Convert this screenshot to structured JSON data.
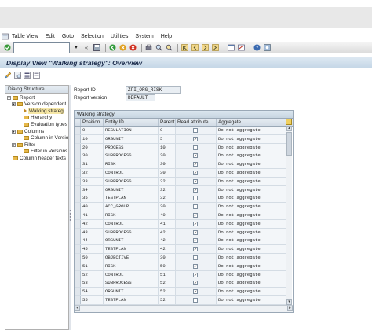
{
  "menu": {
    "items": [
      "Table View",
      "Edit",
      "Goto",
      "Selection",
      "Utilities",
      "System",
      "Help"
    ]
  },
  "toolbar": {
    "command_field_value": "",
    "icons": [
      "enter-icon",
      "save-icon",
      "back-icon",
      "exit-icon",
      "cancel-icon",
      "print-icon",
      "find-icon",
      "find-next-icon",
      "first-page-icon",
      "previous-page-icon",
      "next-page-icon",
      "last-page-icon",
      "create-session-icon",
      "shortcut-icon",
      "help-icon",
      "customize-layout-icon"
    ]
  },
  "title": "Display View \"Walking strategy\": Overview",
  "app_toolbar": {
    "icons": [
      "display-change-icon",
      "details-icon",
      "select-all-icon",
      "deselect-all-icon"
    ]
  },
  "tree": {
    "header": "Dialog Structure",
    "nodes": [
      {
        "label": "Report",
        "level": 0,
        "kind": "folder",
        "toggle": "▾"
      },
      {
        "label": "Version dependent",
        "level": 1,
        "kind": "folder",
        "toggle": "▾"
      },
      {
        "label": "Walking strateg",
        "level": 2,
        "kind": "arrow",
        "toggle": "",
        "selected": true
      },
      {
        "label": "Hierarchy",
        "level": 2,
        "kind": "folder",
        "toggle": ""
      },
      {
        "label": "Evaluation types",
        "level": 2,
        "kind": "folder",
        "toggle": ""
      },
      {
        "label": "Columns",
        "level": 1,
        "kind": "folder",
        "toggle": "▾"
      },
      {
        "label": "Column in Versio",
        "level": 2,
        "kind": "folder",
        "toggle": ""
      },
      {
        "label": "Filter",
        "level": 1,
        "kind": "folder",
        "toggle": "▾"
      },
      {
        "label": "Filter in Versions",
        "level": 2,
        "kind": "folder",
        "toggle": ""
      },
      {
        "label": "Column header texts",
        "level": 0,
        "kind": "folder",
        "toggle": ""
      }
    ]
  },
  "report_fields": {
    "report_id_label": "Report ID",
    "report_id_value": "ZFI_ORG_RISK",
    "report_version_label": "Report version",
    "report_version_value": "DEFAULT"
  },
  "table": {
    "title": "Walking strategy",
    "columns": [
      "Position",
      "Entity ID",
      "Parent",
      "Read attribute",
      "Aggregate"
    ],
    "rows": [
      {
        "position": "0",
        "entity": "REGULATION",
        "parent": "0",
        "read": false,
        "aggregate": "Do not aggregate"
      },
      {
        "position": "10",
        "entity": "ORGUNIT",
        "parent": "5",
        "read": true,
        "aggregate": "Do not aggregate"
      },
      {
        "position": "20",
        "entity": "PROCESS",
        "parent": "10",
        "read": false,
        "aggregate": "Do not aggregate"
      },
      {
        "position": "30",
        "entity": "SUBPROCESS",
        "parent": "20",
        "read": true,
        "aggregate": "Do not aggregate"
      },
      {
        "position": "31",
        "entity": "RISK",
        "parent": "30",
        "read": true,
        "aggregate": "Do not aggregate"
      },
      {
        "position": "32",
        "entity": "CONTROL",
        "parent": "30",
        "read": true,
        "aggregate": "Do not aggregate"
      },
      {
        "position": "33",
        "entity": "SUBPROCESS",
        "parent": "32",
        "read": true,
        "aggregate": "Do not aggregate"
      },
      {
        "position": "34",
        "entity": "ORGUNIT",
        "parent": "32",
        "read": true,
        "aggregate": "Do not aggregate"
      },
      {
        "position": "35",
        "entity": "TESTPLAN",
        "parent": "32",
        "read": false,
        "aggregate": "Do not aggregate"
      },
      {
        "position": "40",
        "entity": "ACC_GROUP",
        "parent": "30",
        "read": false,
        "aggregate": "Do not aggregate"
      },
      {
        "position": "41",
        "entity": "RISK",
        "parent": "40",
        "read": true,
        "aggregate": "Do not aggregate"
      },
      {
        "position": "42",
        "entity": "CONTROL",
        "parent": "41",
        "read": true,
        "aggregate": "Do not aggregate"
      },
      {
        "position": "43",
        "entity": "SUBPROCESS",
        "parent": "42",
        "read": true,
        "aggregate": "Do not aggregate"
      },
      {
        "position": "44",
        "entity": "ORGUNIT",
        "parent": "42",
        "read": true,
        "aggregate": "Do not aggregate"
      },
      {
        "position": "45",
        "entity": "TESTPLAN",
        "parent": "42",
        "read": true,
        "aggregate": "Do not aggregate"
      },
      {
        "position": "50",
        "entity": "OBJECTIVE",
        "parent": "30",
        "read": false,
        "aggregate": "Do not aggregate"
      },
      {
        "position": "51",
        "entity": "RISK",
        "parent": "50",
        "read": true,
        "aggregate": "Do not aggregate"
      },
      {
        "position": "52",
        "entity": "CONTROL",
        "parent": "51",
        "read": true,
        "aggregate": "Do not aggregate"
      },
      {
        "position": "53",
        "entity": "SUBPROCESS",
        "parent": "52",
        "read": true,
        "aggregate": "Do not aggregate"
      },
      {
        "position": "54",
        "entity": "ORGUNIT",
        "parent": "52",
        "read": true,
        "aggregate": "Do not aggregate"
      },
      {
        "position": "55",
        "entity": "TESTPLAN",
        "parent": "52",
        "read": false,
        "aggregate": "Do not aggregate"
      }
    ]
  },
  "colors": {
    "title_bar": "#c4d6e6",
    "title_text": "#1c2c4c",
    "folder": "#e6b84a",
    "selected_node": "#f6e7a6"
  }
}
